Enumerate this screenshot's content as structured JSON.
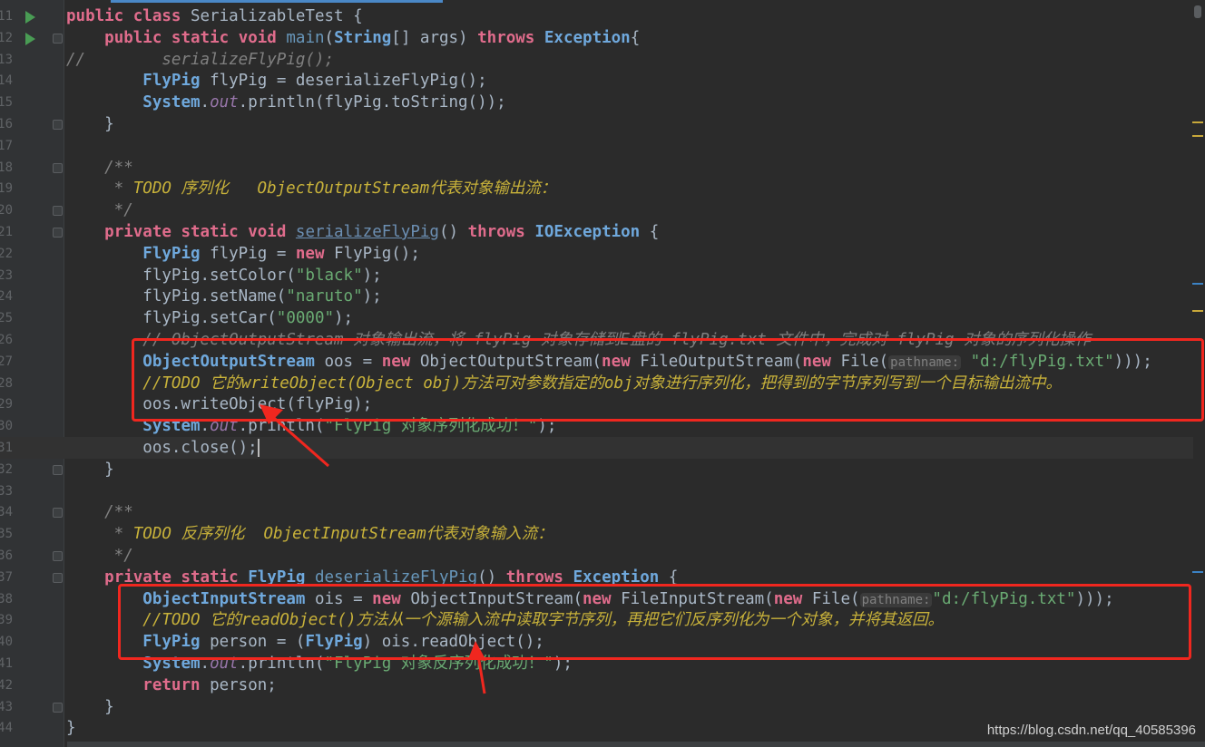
{
  "editor": {
    "lines": [
      {
        "n": "11",
        "segments": [
          [
            "kw2",
            "public "
          ],
          [
            "kw2",
            "class "
          ],
          [
            "plain",
            "SerializableTest {"
          ]
        ]
      },
      {
        "n": "12",
        "segments": [
          [
            "plain",
            "    "
          ],
          [
            "kw2",
            "public "
          ],
          [
            "kw2",
            "static "
          ],
          [
            "kw2",
            "void "
          ],
          [
            "fn",
            "main"
          ],
          [
            "plain",
            "("
          ],
          [
            "type",
            "String"
          ],
          [
            "plain",
            "[] args) "
          ],
          [
            "kw2",
            "throws "
          ],
          [
            "typeb",
            "Exception"
          ],
          [
            "plain",
            "{"
          ]
        ]
      },
      {
        "n": "13",
        "segments": [
          [
            "cm",
            "//        serializeFlyPig();"
          ]
        ]
      },
      {
        "n": "14",
        "segments": [
          [
            "plain",
            "        "
          ],
          [
            "type",
            "FlyPig "
          ],
          [
            "plain",
            "flyPig = deserializeFlyPig();"
          ]
        ]
      },
      {
        "n": "15",
        "segments": [
          [
            "plain",
            "        "
          ],
          [
            "type",
            "System"
          ],
          [
            "plain",
            "."
          ],
          [
            "field",
            "out"
          ],
          [
            "plain",
            ".println(flyPig.toString());"
          ]
        ]
      },
      {
        "n": "16",
        "segments": [
          [
            "plain",
            "    }"
          ]
        ]
      },
      {
        "n": "17",
        "segments": []
      },
      {
        "n": "18",
        "segments": [
          [
            "cm",
            "    /**"
          ]
        ]
      },
      {
        "n": "19",
        "segments": [
          [
            "cm",
            "     * "
          ],
          [
            "todo",
            "TODO 序列化   ObjectOutputStream代表对象输出流："
          ]
        ]
      },
      {
        "n": "20",
        "segments": [
          [
            "cm",
            "     */"
          ]
        ]
      },
      {
        "n": "21",
        "segments": [
          [
            "plain",
            "    "
          ],
          [
            "kw2",
            "private "
          ],
          [
            "kw2",
            "static "
          ],
          [
            "kw2",
            "void "
          ],
          [
            "unused",
            "serializeFlyPig"
          ],
          [
            "plain",
            "() "
          ],
          [
            "kw2",
            "throws "
          ],
          [
            "typeb",
            "IOException "
          ],
          [
            "plain",
            "{"
          ]
        ]
      },
      {
        "n": "22",
        "segments": [
          [
            "plain",
            "        "
          ],
          [
            "type",
            "FlyPig "
          ],
          [
            "plain",
            "flyPig = "
          ],
          [
            "kw2",
            "new "
          ],
          [
            "plain",
            "FlyPig();"
          ]
        ]
      },
      {
        "n": "23",
        "segments": [
          [
            "plain",
            "        flyPig.setColor("
          ],
          [
            "str",
            "\"black\""
          ],
          [
            "plain",
            ");"
          ]
        ]
      },
      {
        "n": "24",
        "segments": [
          [
            "plain",
            "        flyPig.setName("
          ],
          [
            "str",
            "\"naruto\""
          ],
          [
            "plain",
            ");"
          ]
        ]
      },
      {
        "n": "25",
        "segments": [
          [
            "plain",
            "        flyPig.setCar("
          ],
          [
            "str",
            "\"0000\""
          ],
          [
            "plain",
            ");"
          ]
        ]
      },
      {
        "n": "26",
        "segments": [
          [
            "cm",
            "        // ObjectOutputStream 对象输出流，将 flyPig 对象存储到E盘的 flyPig.txt 文件中，完成对 flyPig 对象的序列化操作"
          ]
        ]
      },
      {
        "n": "27",
        "segments": [
          [
            "plain",
            "        "
          ],
          [
            "type",
            "ObjectOutputStream "
          ],
          [
            "plain",
            "oos = "
          ],
          [
            "kw2",
            "new "
          ],
          [
            "plain",
            "ObjectOutputStream("
          ],
          [
            "kw2",
            "new "
          ],
          [
            "plain",
            "FileOutputStream("
          ],
          [
            "kw2",
            "new "
          ],
          [
            "plain",
            "File("
          ],
          [
            "hint",
            "pathname:"
          ],
          [
            "str",
            " \"d:/flyPig.txt\""
          ],
          [
            "plain",
            ")));"
          ]
        ]
      },
      {
        "n": "28",
        "segments": [
          [
            "plain",
            "        "
          ],
          [
            "todo",
            "//TODO 它的writeObject(Object obj)方法可对参数指定的obj对象进行序列化，把得到的字节序列写到一个目标输出流中。"
          ]
        ]
      },
      {
        "n": "29",
        "segments": [
          [
            "plain",
            "        oos.writeObject(flyPig);"
          ]
        ]
      },
      {
        "n": "30",
        "segments": [
          [
            "plain",
            "        "
          ],
          [
            "type",
            "System"
          ],
          [
            "plain",
            "."
          ],
          [
            "field",
            "out"
          ],
          [
            "plain",
            ".println("
          ],
          [
            "str",
            "\"FlyPig 对象序列化成功！\""
          ],
          [
            "plain",
            ");"
          ]
        ]
      },
      {
        "n": "31",
        "segments": [
          [
            "plain",
            "        oos.close();"
          ]
        ],
        "current": true
      },
      {
        "n": "32",
        "segments": [
          [
            "plain",
            "    }"
          ]
        ]
      },
      {
        "n": "33",
        "segments": []
      },
      {
        "n": "34",
        "segments": [
          [
            "cm",
            "    /**"
          ]
        ]
      },
      {
        "n": "35",
        "segments": [
          [
            "cm",
            "     * "
          ],
          [
            "todo",
            "TODO 反序列化  ObjectInputStream代表对象输入流："
          ]
        ]
      },
      {
        "n": "36",
        "segments": [
          [
            "cm",
            "     */"
          ]
        ]
      },
      {
        "n": "37",
        "segments": [
          [
            "plain",
            "    "
          ],
          [
            "kw2",
            "private "
          ],
          [
            "kw2",
            "static "
          ],
          [
            "type",
            "FlyPig "
          ],
          [
            "fn",
            "deserializeFlyPig"
          ],
          [
            "plain",
            "() "
          ],
          [
            "kw2",
            "throws "
          ],
          [
            "typeb",
            "Exception "
          ],
          [
            "plain",
            "{"
          ]
        ]
      },
      {
        "n": "38",
        "segments": [
          [
            "plain",
            "        "
          ],
          [
            "type",
            "ObjectInputStream "
          ],
          [
            "plain",
            "ois = "
          ],
          [
            "kw2",
            "new "
          ],
          [
            "plain",
            "ObjectInputStream("
          ],
          [
            "kw2",
            "new "
          ],
          [
            "plain",
            "FileInputStream("
          ],
          [
            "kw2",
            "new "
          ],
          [
            "plain",
            "File("
          ],
          [
            "hint",
            "pathname:"
          ],
          [
            "str",
            "\"d:/flyPig.txt\""
          ],
          [
            "plain",
            ")));"
          ]
        ]
      },
      {
        "n": "39",
        "segments": [
          [
            "plain",
            "        "
          ],
          [
            "todo",
            "//TODO 它的readObject()方法从一个源输入流中读取字节序列，再把它们反序列化为一个对象，并将其返回。"
          ]
        ]
      },
      {
        "n": "40",
        "segments": [
          [
            "plain",
            "        "
          ],
          [
            "type",
            "FlyPig "
          ],
          [
            "plain",
            "person = ("
          ],
          [
            "type",
            "FlyPig"
          ],
          [
            "plain",
            ") ois.readObject();"
          ]
        ]
      },
      {
        "n": "41",
        "segments": [
          [
            "plain",
            "        "
          ],
          [
            "type",
            "System"
          ],
          [
            "plain",
            "."
          ],
          [
            "field",
            "out"
          ],
          [
            "plain",
            ".println("
          ],
          [
            "str",
            "\"FlyPig 对象反序列化成功！\""
          ],
          [
            "plain",
            ");"
          ]
        ]
      },
      {
        "n": "42",
        "segments": [
          [
            "plain",
            "        "
          ],
          [
            "kw2",
            "return "
          ],
          [
            "plain",
            "person;"
          ]
        ]
      },
      {
        "n": "43",
        "segments": [
          [
            "plain",
            "    }"
          ]
        ]
      },
      {
        "n": "44",
        "segments": [
          [
            "plain",
            "}"
          ]
        ]
      }
    ]
  },
  "watermark": "https://blog.csdn.net/qq_40585396",
  "colors": {
    "highlight_box": "#f0271f",
    "background": "#2b2b2b",
    "gutter": "#313335"
  }
}
